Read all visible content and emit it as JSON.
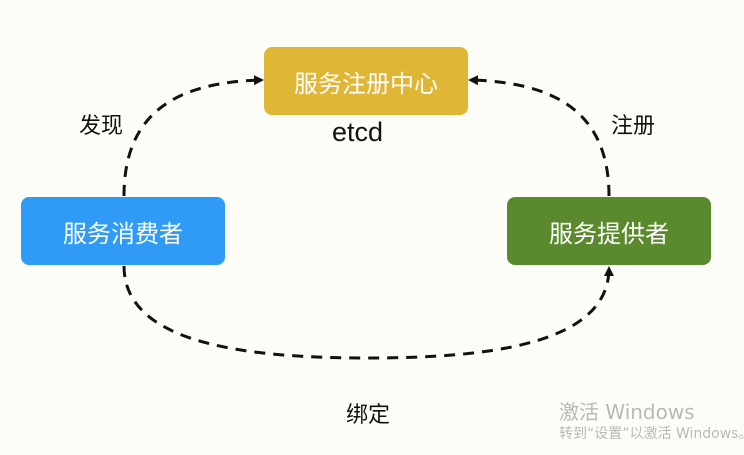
{
  "diagram": {
    "nodes": {
      "registry": {
        "label": "服务注册中心",
        "sublabel": "etcd",
        "color": "#e0b636"
      },
      "consumer": {
        "label": "服务消费者",
        "color": "#2f9bf7"
      },
      "provider": {
        "label": "服务提供者",
        "color": "#5b8a2e"
      }
    },
    "edges": {
      "discover": {
        "label": "发现",
        "from": "consumer",
        "to": "registry"
      },
      "register": {
        "label": "注册",
        "from": "provider",
        "to": "registry"
      },
      "bind": {
        "label": "绑定",
        "from": "consumer",
        "to": "provider"
      }
    },
    "edge_style": "dashed"
  },
  "watermark": {
    "title": "激活 Windows",
    "subtitle": "转到“设置”以激活 Windows。"
  }
}
